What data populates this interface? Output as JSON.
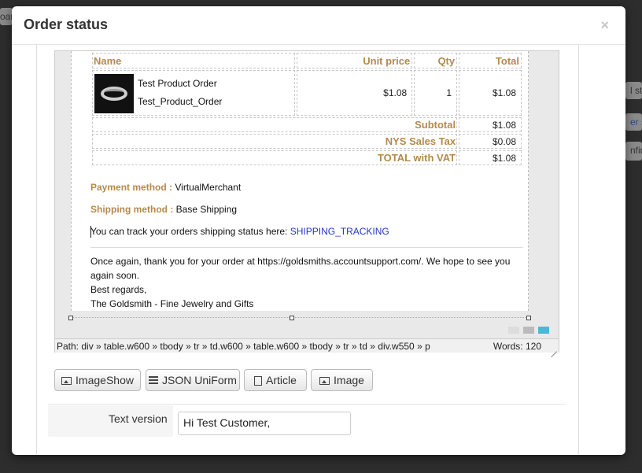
{
  "background": {
    "left_chip": "oar",
    "right_chip_1": "l st",
    "right_chip_2": "er s",
    "right_chip_3": "nfir"
  },
  "modal": {
    "title": "Order status",
    "close_label": "×"
  },
  "order_table": {
    "headers": {
      "name": "Name",
      "unit_price": "Unit price",
      "qty": "Qty",
      "total": "Total"
    },
    "product": {
      "line1": "Test Product Order",
      "line2": "Test_Product_Order",
      "unit_price": "$1.08",
      "qty": "1",
      "total": "$1.08"
    },
    "summary": [
      {
        "label": "Subtotal",
        "value": "$1.08"
      },
      {
        "label": "NYS Sales Tax",
        "value": "$0.08"
      },
      {
        "label": "TOTAL with VAT",
        "value": "$1.08"
      }
    ]
  },
  "payment": {
    "label": "Payment method :",
    "value": "VirtualMerchant"
  },
  "shipping": {
    "label": "Shipping method :",
    "value": "Base Shipping"
  },
  "tracking": {
    "text": "You can track your orders shipping status here:",
    "link": "SHIPPING_TRACKING"
  },
  "thanks": {
    "line1": "Once again, thank you for your order at https://goldsmiths.accountsupport.com/. We hope to see you again soon.",
    "line2": "Best regards,",
    "line3": "The Goldsmith - Fine Jewelry and Gifts"
  },
  "editor_status": {
    "path": "Path:  div » table.w600 » tbody » tr » td.w600 » table.w600 » tbody » tr » td » div.w550 » p",
    "words": "Words: 120"
  },
  "swatch_colors": [
    "#dddddd",
    "#bbbbbb",
    "#4db8d6"
  ],
  "buttons": {
    "imageshow": "ImageShow",
    "json_uniform": "JSON UniForm",
    "article": "Article",
    "image": "Image"
  },
  "text_version": {
    "label": "Text version",
    "value": "Hi Test Customer,"
  }
}
